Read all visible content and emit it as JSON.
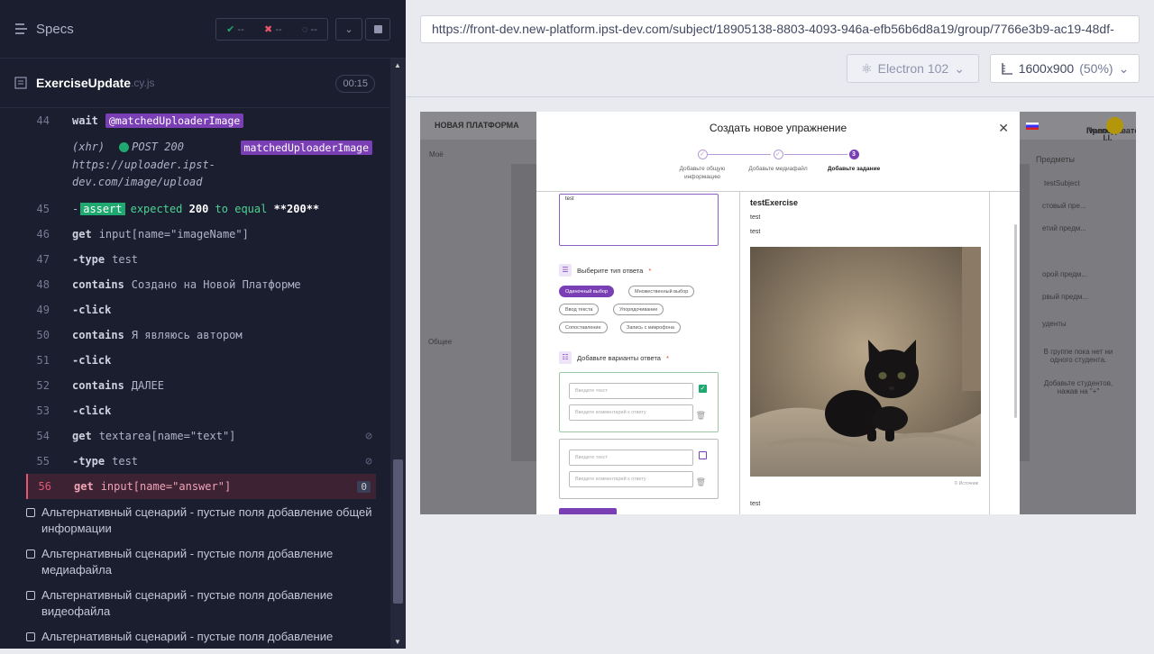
{
  "header": {
    "specs_label": "Specs",
    "passed": "--",
    "failed": "--",
    "pending": "--"
  },
  "spec_file": {
    "name": "ExerciseUpdate",
    "ext": ".cy.js",
    "duration": "00:15"
  },
  "commands": [
    {
      "num": "44",
      "kw": "wait",
      "alias": "@matchedUploaderImage"
    },
    {
      "num": "45",
      "kw": "-assert",
      "text": "expected 200 to equal **200**"
    },
    {
      "num": "46",
      "kw": "get",
      "arg": "input[name=\"imageName\"]"
    },
    {
      "num": "47",
      "kw": "-type",
      "arg": "test"
    },
    {
      "num": "48",
      "kw": "contains",
      "arg": "Создано на Новой Платформе"
    },
    {
      "num": "49",
      "kw": "-click",
      "arg": ""
    },
    {
      "num": "50",
      "kw": "contains",
      "arg": "Я являюсь автором"
    },
    {
      "num": "51",
      "kw": "-click",
      "arg": ""
    },
    {
      "num": "52",
      "kw": "contains",
      "arg": "ДАЛЕЕ"
    },
    {
      "num": "53",
      "kw": "-click",
      "arg": ""
    },
    {
      "num": "54",
      "kw": "get",
      "arg": "textarea[name=\"text\"]"
    },
    {
      "num": "55",
      "kw": "-type",
      "arg": "test"
    },
    {
      "num": "56",
      "kw": "get",
      "arg": "input[name=\"answer\"]",
      "count": "0"
    }
  ],
  "xhr": {
    "type": "(xhr)",
    "method": "POST 200",
    "url": "https://uploader.ipst-dev.com/image/upload",
    "alias": "matchedUploaderImage"
  },
  "assert": {
    "label": "assert",
    "w1": "expected",
    "v1": "200",
    "w2": "to equal",
    "v2": "**200**"
  },
  "tests": [
    "Альтернативный сценарий - пустые поля добавление общей информации",
    "Альтернативный сценарий - пустые поля добавление медиафайла",
    "Альтернативный сценарий - пустые поля добавление видеофайла",
    "Альтернативный сценарий - пустые поля добавление"
  ],
  "browser": {
    "url": "https://front-dev.new-platform.ipst-dev.com/subject/18905138-8803-4093-946a-efb56b6d8a19/group/7766e3b9-ac19-48df-",
    "engine": "Electron 102",
    "viewport": "1600x900",
    "zoom": "(50%)"
  },
  "app": {
    "nav_title": "НОВАЯ ПЛАТФОРМА",
    "user": "Ivanov I.I.",
    "role": "Преподаватель",
    "bg_labels": [
      "Моё",
      "Предметы",
      "testSubject",
      "стовый пре...",
      "етий предм...",
      "орой предм...",
      "рвый предм...",
      "уденты",
      "В группе пока нет ни одного студента.",
      "Добавьте студентов, нажав на \"+\"",
      "Общее"
    ],
    "modal": {
      "title": "Создать новое упражнение",
      "steps": [
        "Добавьте общую информацию",
        "Добавьте медиафайл",
        "Добавьте задание"
      ],
      "step3_num": "3",
      "textarea_value": "test",
      "answer_type_label": "Выберите тип ответа",
      "answer_types": [
        "Одиночный выбор",
        "Множественный выбор",
        "Ввод текста",
        "Упорядочивание",
        "Сопоставление",
        "Запись с микрофона"
      ],
      "variants_label": "Добавьте варианты ответа",
      "text_placeholder": "Введите текст",
      "comment_placeholder": "Введите комментарий к ответу",
      "preview_title": "testExercise",
      "preview_line1": "test",
      "preview_line2": "test",
      "preview_source": "© Источник",
      "preview_bottom": "test"
    }
  }
}
